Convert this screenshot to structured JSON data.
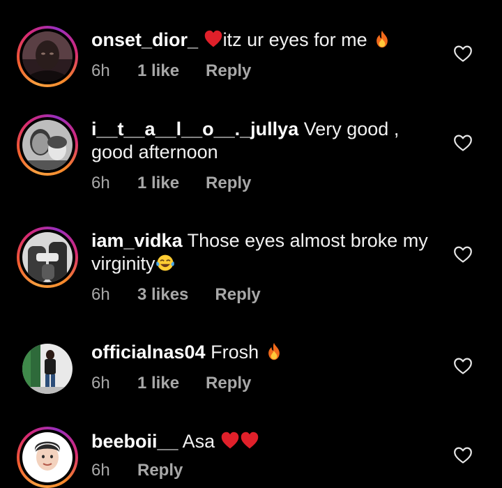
{
  "comments": [
    {
      "username": "onset_dior_",
      "text_before": "",
      "text": "itz ur eyes for me ",
      "lead_emoji": "red-heart",
      "trail_emoji": "fire",
      "time": "6h",
      "likes": "1 like",
      "reply": "Reply",
      "avatar_icon": "profile-photo",
      "has_story_ring": true
    },
    {
      "username": "i__t__a__l__o__._jullya",
      "text": "Very good , good afternoon",
      "time": "6h",
      "likes": "1 like",
      "reply": "Reply",
      "avatar_icon": "profile-photo",
      "has_story_ring": true
    },
    {
      "username": "iam_vidka",
      "text": "Those eyes almost broke my virginity",
      "trail_emoji": "tears-of-joy",
      "time": "6h",
      "likes": "3 likes",
      "reply": "Reply",
      "avatar_icon": "profile-photo",
      "has_story_ring": true
    },
    {
      "username": "officialnas04",
      "text": "Frosh ",
      "trail_emoji": "fire",
      "time": "6h",
      "likes": "1 like",
      "reply": "Reply",
      "avatar_icon": "profile-photo",
      "has_story_ring": false
    },
    {
      "username": "beeboii__",
      "text": "Asa ",
      "trail_emoji": "two-red-hearts",
      "time": "6h",
      "likes": "",
      "reply": "Reply",
      "avatar_icon": "profile-photo",
      "has_story_ring": true
    }
  ],
  "icons": {
    "like": "heart-outline-icon"
  },
  "colors": {
    "background": "#000000",
    "secondary_text": "#a8a8a8",
    "story_ring_start": "#f9a03f",
    "story_ring_end": "#d62976"
  }
}
